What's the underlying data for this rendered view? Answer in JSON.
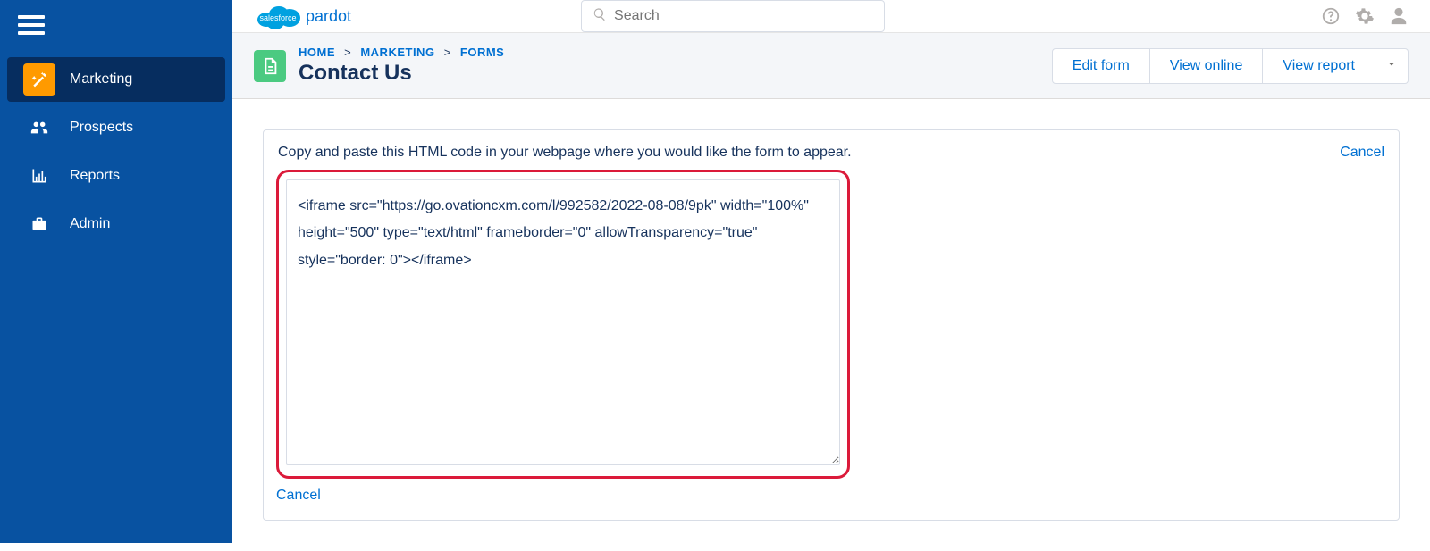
{
  "brand": {
    "logo_text": "salesforce",
    "sub": "pardot"
  },
  "search": {
    "placeholder": "Search"
  },
  "sidebar": {
    "items": [
      {
        "label": "Marketing"
      },
      {
        "label": "Prospects"
      },
      {
        "label": "Reports"
      },
      {
        "label": "Admin"
      }
    ]
  },
  "breadcrumbs": {
    "home": "HOME",
    "marketing": "MARKETING",
    "forms": "FORMS",
    "sep": ">"
  },
  "page": {
    "title": "Contact Us"
  },
  "actions": {
    "edit": "Edit form",
    "view_online": "View online",
    "view_report": "View report"
  },
  "panel": {
    "instruction": "Copy and paste this HTML code in your webpage where you would like the form to appear.",
    "cancel": "Cancel",
    "code": "<iframe src=\"https://go.ovationcxm.com/l/992582/2022-08-08/9pk\" width=\"100%\" height=\"500\" type=\"text/html\" frameborder=\"0\" allowTransparency=\"true\" style=\"border: 0\"></iframe>"
  }
}
